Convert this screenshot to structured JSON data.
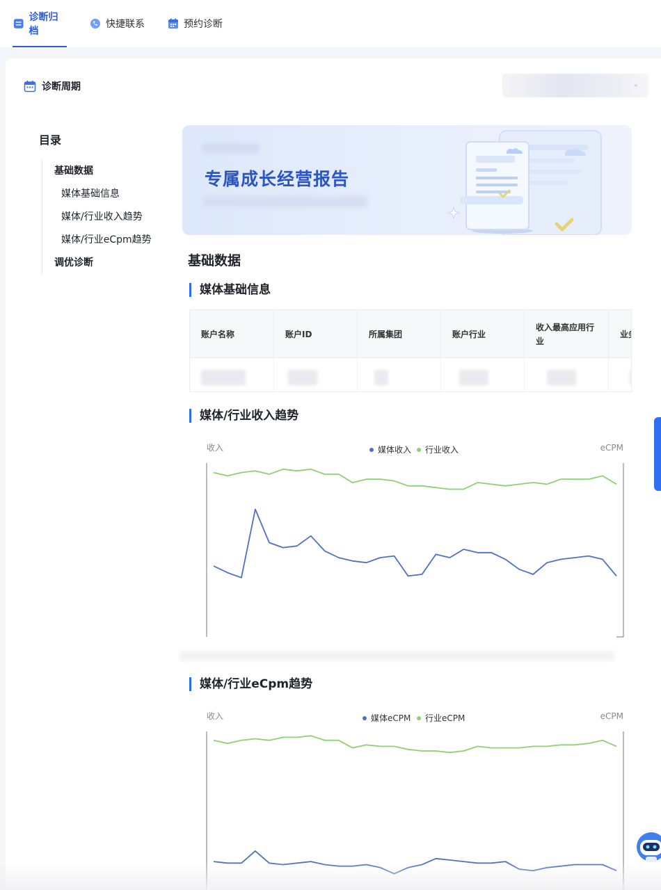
{
  "tabs": [
    {
      "label": "诊断归档",
      "icon": "archive-icon",
      "active": true
    },
    {
      "label": "快捷联系",
      "icon": "contact-icon",
      "active": false
    },
    {
      "label": "预约诊断",
      "icon": "calendar-icon",
      "active": false
    }
  ],
  "period": {
    "label": "诊断周期",
    "icon": "calendar-icon"
  },
  "toc": {
    "title": "目录",
    "items": [
      {
        "label": "基础数据",
        "level": 1
      },
      {
        "label": "媒体基础信息",
        "level": 2
      },
      {
        "label": "媒体/行业收入趋势",
        "level": 2
      },
      {
        "label": "媒体/行业eCpm趋势",
        "level": 2
      },
      {
        "label": "调优诊断",
        "level": 1
      }
    ]
  },
  "banner": {
    "title": "专属成长经营报告"
  },
  "section": {
    "title": "基础数据"
  },
  "media_info": {
    "title": "媒体基础信息",
    "columns": [
      "账户名称",
      "账户ID",
      "所属集团",
      "账户行业",
      "收入最高应用行业",
      "业务"
    ]
  },
  "revenue_chart": {
    "title": "媒体/行业收入趋势"
  },
  "ecpm_chart": {
    "title": "媒体/行业eCpm趋势"
  },
  "colors": {
    "accent": "#2e5bd6",
    "media_series": "#4f6fc4",
    "industry_series": "#8fd16f"
  },
  "chart_data": [
    {
      "type": "line",
      "left_axis_label": "收入",
      "right_axis_label": "eCPM",
      "legend_position": "top-center",
      "series": [
        {
          "name": "媒体收入",
          "axis": "left",
          "values": [
            40,
            36,
            33,
            74,
            54,
            51,
            52,
            58,
            49,
            45,
            43,
            42,
            45,
            46,
            34,
            35,
            47,
            45,
            50,
            48,
            48,
            44,
            38,
            35,
            42,
            44,
            45,
            46,
            44,
            34
          ]
        },
        {
          "name": "行业收入",
          "axis": "right",
          "values": [
            96,
            94,
            96,
            97,
            95,
            98,
            97,
            98,
            95,
            95,
            90,
            92,
            92,
            91,
            88,
            88,
            87,
            86,
            86,
            90,
            89,
            88,
            89,
            90,
            89,
            92,
            92,
            92,
            94,
            89
          ]
        }
      ]
    },
    {
      "type": "line",
      "left_axis_label": "收入",
      "right_axis_label": "eCPM",
      "legend_position": "top-center",
      "series": [
        {
          "name": "媒体eCPM",
          "axis": "left",
          "values": [
            16,
            15,
            15,
            23,
            15,
            14,
            15,
            16,
            14,
            13,
            13,
            14,
            12,
            8,
            12,
            14,
            18,
            17,
            16,
            15,
            15,
            16,
            11,
            10,
            12,
            13,
            14,
            14,
            14,
            10
          ]
        },
        {
          "name": "行业eCPM",
          "axis": "right",
          "values": [
            96,
            94,
            96,
            97,
            96,
            98,
            98,
            99,
            96,
            96,
            91,
            93,
            92,
            92,
            90,
            89,
            89,
            88,
            89,
            92,
            91,
            91,
            91,
            92,
            92,
            93,
            93,
            94,
            96,
            92
          ]
        }
      ]
    }
  ]
}
